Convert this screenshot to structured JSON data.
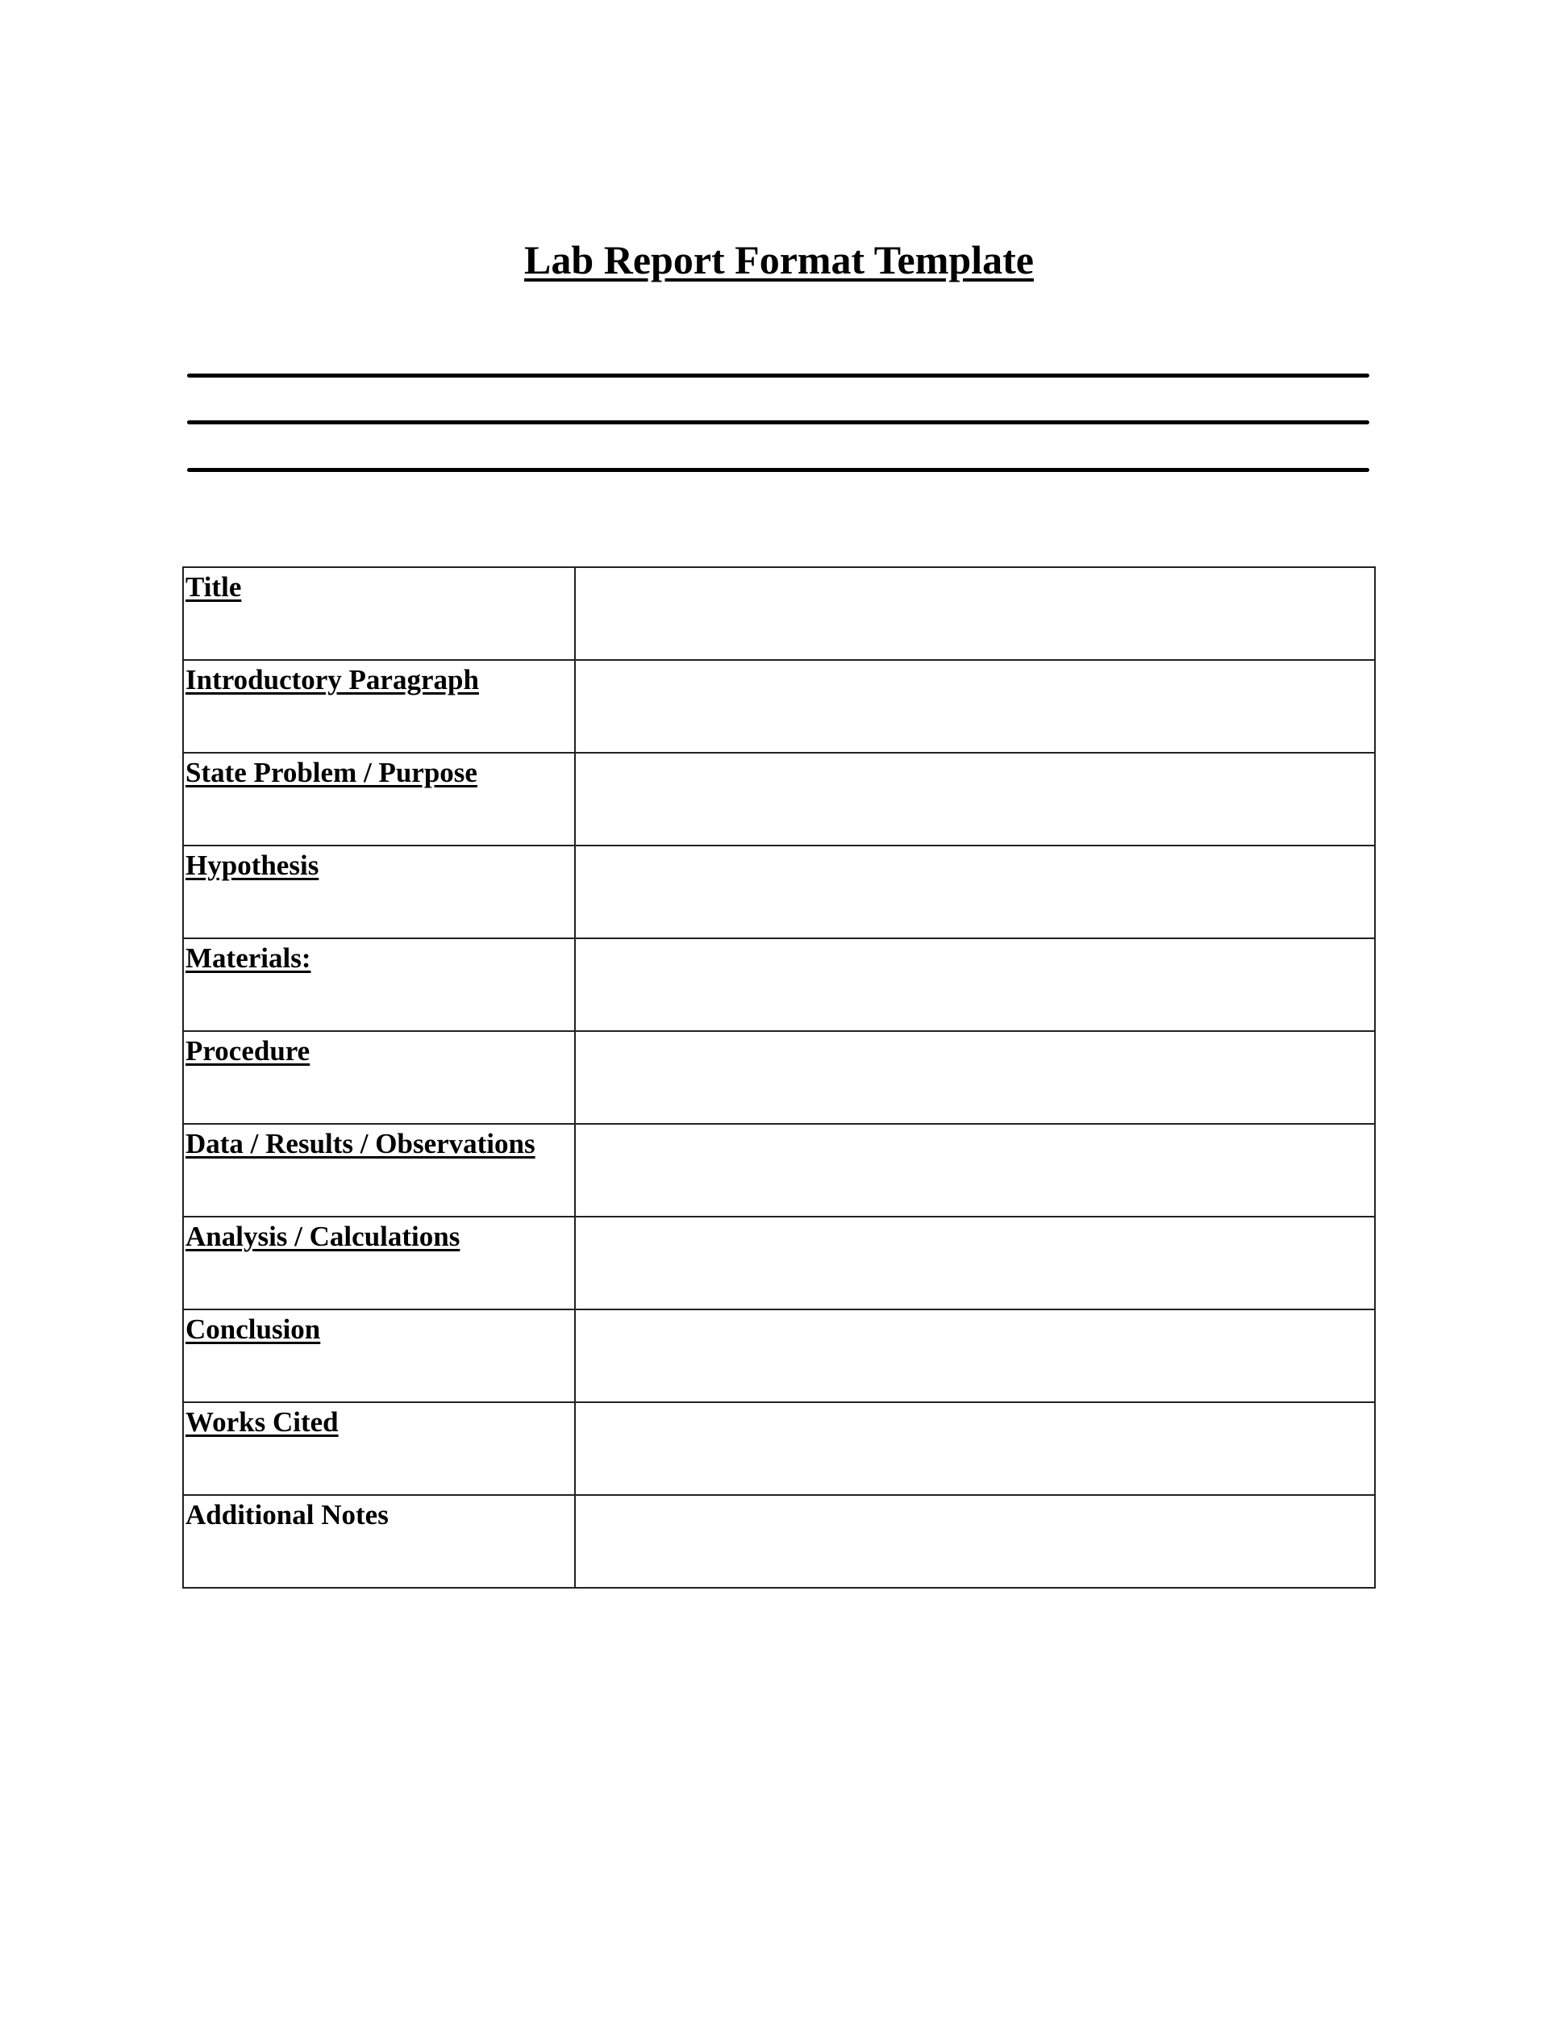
{
  "document": {
    "title": "Lab Report Format Template",
    "blank_lines": 3,
    "sections": [
      {
        "label": "Title",
        "underlined": true,
        "value": ""
      },
      {
        "label": "Introductory Paragraph",
        "underlined": true,
        "value": ""
      },
      {
        "label": "State Problem / Purpose",
        "underlined": true,
        "value": ""
      },
      {
        "label": "Hypothesis",
        "underlined": true,
        "value": ""
      },
      {
        "label": "Materials:",
        "underlined": true,
        "value": ""
      },
      {
        "label": "Procedure",
        "underlined": true,
        "value": ""
      },
      {
        "label": "Data / Results / Observations",
        "underlined": true,
        "value": ""
      },
      {
        "label": "Analysis / Calculations",
        "underlined": true,
        "value": ""
      },
      {
        "label": "Conclusion",
        "underlined": true,
        "value": ""
      },
      {
        "label": "Works Cited",
        "underlined": true,
        "value": ""
      },
      {
        "label": "Additional Notes",
        "underlined": false,
        "value": ""
      }
    ]
  }
}
